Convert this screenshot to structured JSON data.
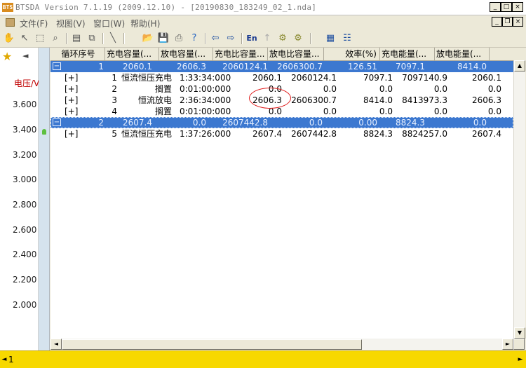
{
  "window": {
    "title": "BTSDA Version 7.1.19 (2009.12.10)   - [20190830_183249_02_1.nda]",
    "app_icon_text": "BTS",
    "min": "_",
    "max": "□",
    "close": "×"
  },
  "menu": {
    "items": [
      "文件(F)",
      "视图(V)",
      "窗口(W)",
      "帮助(H)"
    ],
    "mdi_min": "_",
    "mdi_restore": "❐",
    "mdi_close": "×"
  },
  "toolbar": {
    "en_label": "En"
  },
  "left_panel": {
    "voltage_label": "电压/V",
    "ticks": [
      "3.600",
      "3.400",
      "3.200",
      "3.000",
      "2.800",
      "2.600",
      "2.400",
      "2.200",
      "2.000"
    ]
  },
  "table": {
    "columns": [
      "循环序号",
      "充电容量(...",
      "放电容量(...",
      "充电比容量...",
      "放电比容量...",
      "效率(%)",
      "充电能量(...",
      "放电能量(..."
    ],
    "cycles": [
      {
        "toggle": "−",
        "cycle": "1",
        "charge_cap": "2060.1",
        "discharge_cap": "2606.3",
        "charge_spec": "2060124.1",
        "discharge_spec": "2606300.7",
        "efficiency": "126.51",
        "charge_energy": "7097.1",
        "discharge_energy": "8414.0",
        "steps": [
          {
            "expand": "[+]",
            "num": "1",
            "name": "恒流恒压充电",
            "time": "1:33:34:000",
            "cap": "2060.1",
            "spec": "2060124.1",
            "energy": "7097.1",
            "spec_energy": "7097140.9",
            "last": "2060.1"
          },
          {
            "expand": "[+]",
            "num": "2",
            "name": "搁置",
            "time": "0:01:00:000",
            "cap": "0.0",
            "spec": "0.0",
            "energy": "0.0",
            "spec_energy": "0.0",
            "last": "0.0"
          },
          {
            "expand": "[+]",
            "num": "3",
            "name": "恒流放电",
            "time": "2:36:34:000",
            "cap": "2606.3",
            "spec": "2606300.7",
            "energy": "8414.0",
            "spec_energy": "8413973.3",
            "last": "2606.3"
          },
          {
            "expand": "[+]",
            "num": "4",
            "name": "搁置",
            "time": "0:01:00:000",
            "cap": "0.0",
            "spec": "0.0",
            "energy": "0.0",
            "spec_energy": "0.0",
            "last": "0.0"
          }
        ]
      },
      {
        "toggle": "−",
        "cycle": "2",
        "charge_cap": "2607.4",
        "discharge_cap": "0.0",
        "charge_spec": "2607442.8",
        "discharge_spec": "0.0",
        "efficiency": "0.00",
        "charge_energy": "8824.3",
        "discharge_energy": "0.0",
        "steps": [
          {
            "expand": "[+]",
            "num": "5",
            "name": "恒流恒压充电",
            "time": "1:37:26:000",
            "cap": "2607.4",
            "spec": "2607442.8",
            "energy": "8824.3",
            "spec_energy": "8824257.0",
            "last": "2607.4"
          }
        ]
      }
    ]
  },
  "status": {
    "left_text": "1"
  }
}
